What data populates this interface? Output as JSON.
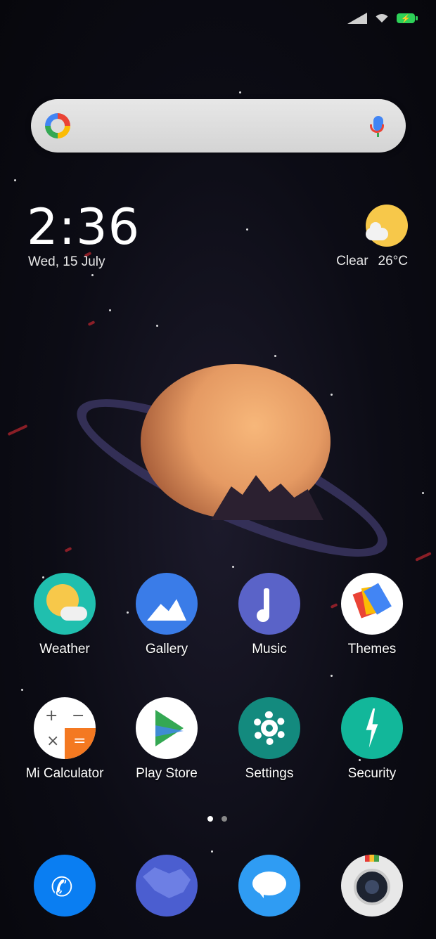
{
  "status_bar": {
    "signal_icon": "signal-icon",
    "wifi_icon": "wifi-icon",
    "battery_icon": "battery-charging-icon",
    "battery_color": "#2ed158"
  },
  "search": {
    "logo": "google-g-icon",
    "mic_icon": "mic-icon"
  },
  "clock": {
    "time": "2:36",
    "date": "Wed, 15 July"
  },
  "weather": {
    "condition": "Clear",
    "temperature": "26°C",
    "icon": "sun-cloud-icon"
  },
  "apps": [
    {
      "label": "Weather",
      "icon": "weather-icon"
    },
    {
      "label": "Gallery",
      "icon": "gallery-icon"
    },
    {
      "label": "Music",
      "icon": "music-icon"
    },
    {
      "label": "Themes",
      "icon": "themes-icon"
    },
    {
      "label": "Mi Calculator",
      "icon": "calculator-icon"
    },
    {
      "label": "Play Store",
      "icon": "play-store-icon"
    },
    {
      "label": "Settings",
      "icon": "settings-icon"
    },
    {
      "label": "Security",
      "icon": "security-icon"
    }
  ],
  "calc": {
    "plus": "+",
    "minus": "−",
    "times": "×",
    "equals": "="
  },
  "page_indicator": {
    "pages": 2,
    "active": 1
  },
  "dock": [
    {
      "icon": "phone-icon",
      "symbol": "✆"
    },
    {
      "icon": "browser-icon"
    },
    {
      "icon": "messages-icon"
    },
    {
      "icon": "camera-icon"
    }
  ]
}
